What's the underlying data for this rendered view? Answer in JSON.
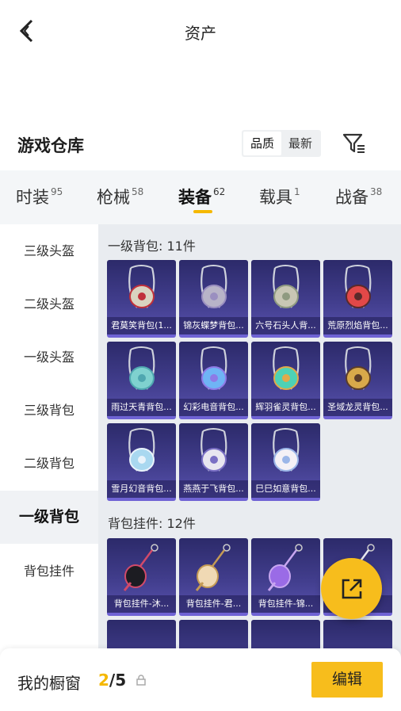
{
  "header": {
    "title": "资产"
  },
  "warehouse": {
    "title": "游戏仓库",
    "sort_options": [
      "品质",
      "最新"
    ],
    "sort_selected": "品质"
  },
  "tabs": [
    {
      "label": "时装",
      "count": "95"
    },
    {
      "label": "枪械",
      "count": "58"
    },
    {
      "label": "装备",
      "count": "62",
      "active": true
    },
    {
      "label": "载具",
      "count": "1"
    },
    {
      "label": "战备",
      "count": "38"
    }
  ],
  "sidebar": {
    "items": [
      "三级头盔",
      "二级头盔",
      "一级头盔",
      "三级背包",
      "二级背包",
      "一级背包",
      "背包挂件"
    ],
    "active": "一级背包"
  },
  "sections": [
    {
      "title": "一级背包: 11件",
      "items": [
        {
          "name": "君莫笑背包(1...",
          "icon": "backpack-crimson-charm"
        },
        {
          "name": "锦灰蝶梦背包...",
          "icon": "backpack-gray-butterfly"
        },
        {
          "name": "六号石头人背...",
          "icon": "backpack-stone-golem"
        },
        {
          "name": "荒原烈焰背包...",
          "icon": "backpack-red-flame"
        },
        {
          "name": "雨过天青背包...",
          "icon": "backpack-sky-blue"
        },
        {
          "name": "幻彩电音背包...",
          "icon": "backpack-neon-disc"
        },
        {
          "name": "辉羽雀灵背包...",
          "icon": "backpack-teal-bird"
        },
        {
          "name": "圣域龙灵背包...",
          "icon": "backpack-gold-dragon"
        },
        {
          "name": "雪月幻音背包...",
          "icon": "backpack-snow-moon"
        },
        {
          "name": "燕燕于飞背包...",
          "icon": "backpack-swallow"
        },
        {
          "name": "巳巳如意背包...",
          "icon": "backpack-white-bunny"
        }
      ]
    },
    {
      "title": "背包挂件: 12件",
      "items": [
        {
          "name": "背包挂件-沐...",
          "icon": "charm-black-cat"
        },
        {
          "name": "背包挂件-君...",
          "icon": "charm-umbrella"
        },
        {
          "name": "背包挂件-锦...",
          "icon": "charm-purple-feather"
        },
        {
          "name": "...",
          "icon": "charm-chain"
        }
      ]
    }
  ],
  "fab": {
    "icon": "share-export-icon"
  },
  "bottom": {
    "showcase_label": "我的橱窗",
    "showcase_current": "2",
    "showcase_total": "/5",
    "edit_label": "编辑"
  },
  "colors": {
    "accent": "#f7bd1c",
    "card_bg": "#413d8c",
    "underline": "#f5b800"
  }
}
